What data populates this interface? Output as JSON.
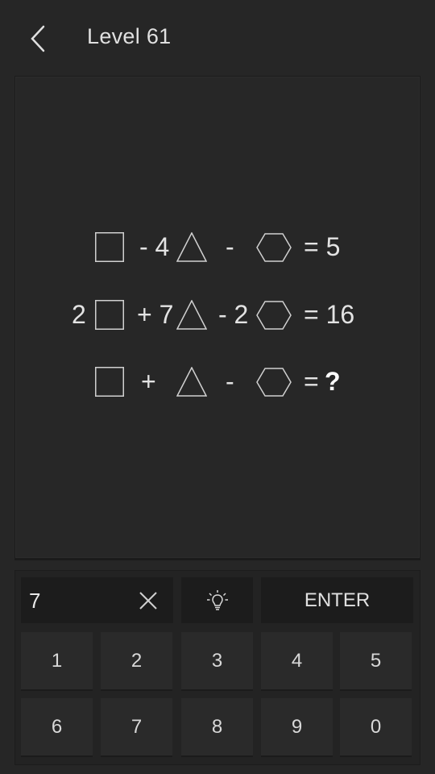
{
  "header": {
    "title": "Level 61",
    "back_icon": "chevron-left-icon"
  },
  "puzzle": {
    "equations": [
      {
        "c1": "",
        "op1": "- 4",
        "op2": "-",
        "result": "= 5"
      },
      {
        "c1": "2",
        "op1": "+ 7",
        "op2": "- 2",
        "result": "= 16"
      },
      {
        "c1": "",
        "op1": "+",
        "op2": "-",
        "result": "= ",
        "unknown": "?"
      }
    ],
    "shapes": [
      "square-icon",
      "triangle-icon",
      "hexagon-icon"
    ]
  },
  "answer": {
    "value": "7",
    "clear_icon": "close-icon"
  },
  "actions": {
    "hint_icon": "lightbulb-icon",
    "enter_label": "ENTER"
  },
  "keys": [
    "1",
    "2",
    "3",
    "4",
    "5",
    "6",
    "7",
    "8",
    "9",
    "0"
  ]
}
